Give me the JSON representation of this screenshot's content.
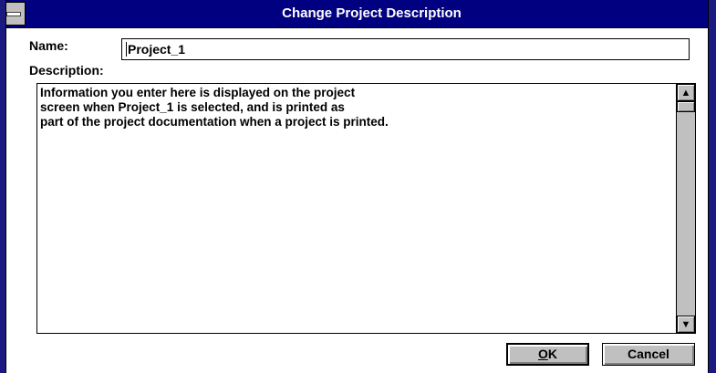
{
  "window": {
    "title": "Change Project Description"
  },
  "icons": {
    "system_menu": "system-menu-icon",
    "scroll_up": "arrow-up-icon",
    "scroll_down": "arrow-down-icon"
  },
  "name_field": {
    "label": "Name:",
    "value": "Project_1"
  },
  "description": {
    "label": "Description:",
    "text": "Information you enter here is displayed on the project\nscreen when Project_1 is selected, and is printed as\npart of the project documentation when a project is printed."
  },
  "buttons": {
    "ok_mnemonic": "O",
    "ok_rest": "K",
    "cancel": "Cancel"
  },
  "colors": {
    "titlebar": "#000080",
    "face": "#c0c0c0"
  }
}
